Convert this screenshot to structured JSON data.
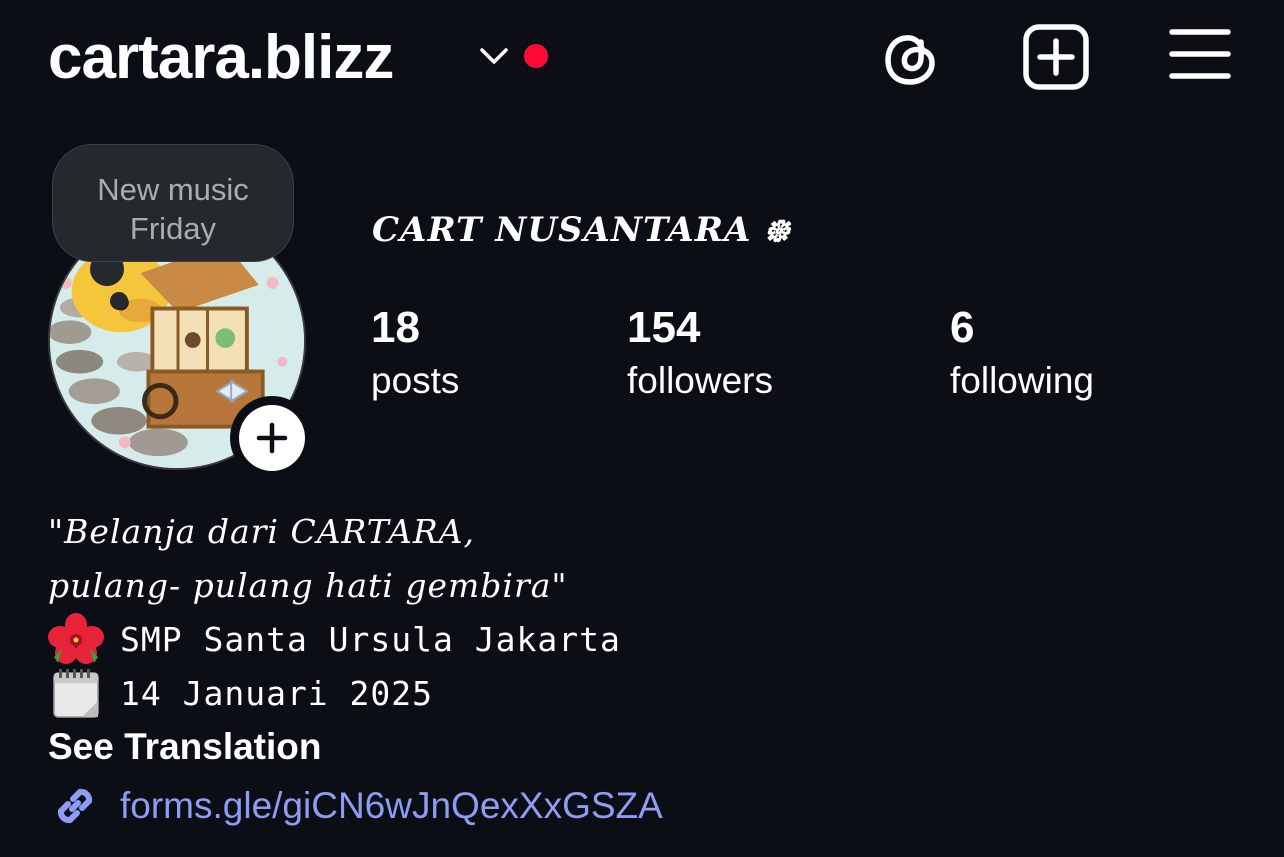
{
  "header": {
    "username": "cartara.blizz",
    "icons": [
      "chevron-down-icon",
      "threads-icon",
      "new-post-icon",
      "menu-icon"
    ],
    "notification_color": "#ff0a35"
  },
  "profile": {
    "note": {
      "line1": "New music",
      "line2": "Friday"
    },
    "display_name": "CART NUSANTARA ᪥",
    "stats": {
      "posts": {
        "value": "18",
        "label": "posts"
      },
      "followers": {
        "value": "154",
        "label": "followers"
      },
      "following": {
        "value": "6",
        "label": "following"
      }
    }
  },
  "bio": {
    "quote_line1": "\"Belanja dari CARTARA,",
    "quote_line2": "pulang- pulang hati gembira\"",
    "school_emoji": "🌺",
    "school": "SMP Santa Ursula Jakarta",
    "date_emoji": "🗓️",
    "date": "14 Januari 2025",
    "see_translation": "See Translation",
    "link": "forms.gle/giCN6wJnQexXxGSZA",
    "link_color": "#8f9cf5"
  },
  "theme": {
    "background": "#0b0f15",
    "text": "#ffffff"
  }
}
